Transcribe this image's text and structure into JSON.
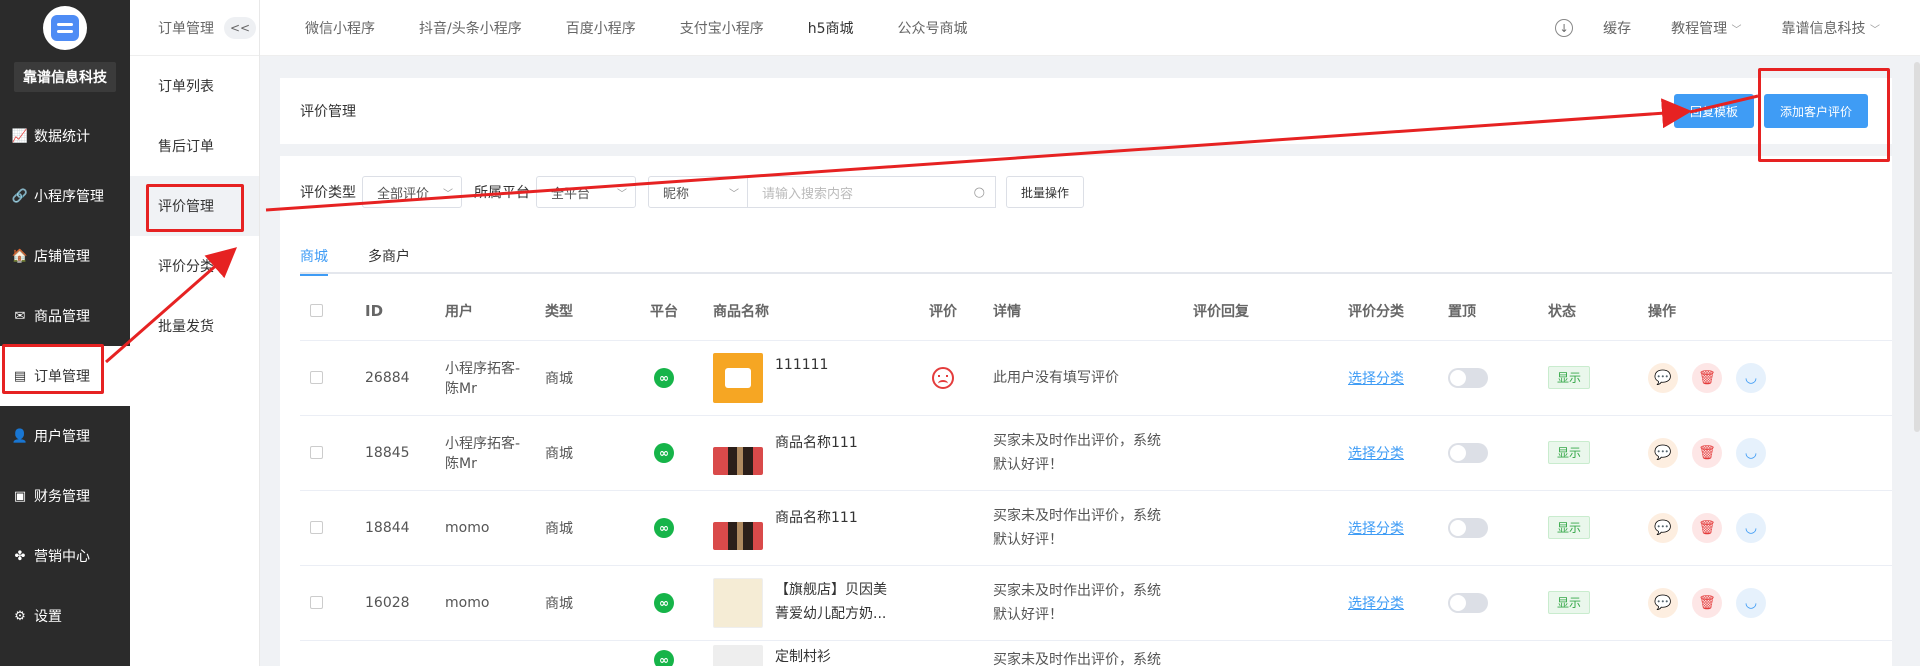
{
  "sidebar": {
    "company": "靠谱信息科技",
    "items": [
      {
        "label": "数据统计",
        "icon": "chart-icon"
      },
      {
        "label": "小程序管理",
        "icon": "link-icon"
      },
      {
        "label": "店铺管理",
        "icon": "store-icon"
      },
      {
        "label": "商品管理",
        "icon": "goods-icon"
      },
      {
        "label": "订单管理",
        "icon": "order-icon"
      },
      {
        "label": "用户管理",
        "icon": "user-icon"
      },
      {
        "label": "财务管理",
        "icon": "finance-icon"
      },
      {
        "label": "营销中心",
        "icon": "marketing-icon"
      },
      {
        "label": "设置",
        "icon": "gear-icon"
      }
    ]
  },
  "subnav": {
    "title": "订单管理",
    "collapse": "<<",
    "items": [
      "订单列表",
      "售后订单",
      "评价管理",
      "评价分类",
      "批量发货"
    ]
  },
  "topbar": {
    "tabs": [
      "微信小程序",
      "抖音/头条小程序",
      "百度小程序",
      "支付宝小程序",
      "h5商城",
      "公众号商城"
    ],
    "cache": "缓存",
    "tutorial": "教程管理",
    "account": "靠谱信息科技"
  },
  "header": {
    "title": "评价管理",
    "reply_template": "回复模板",
    "add_review": "添加客户评价"
  },
  "filters": {
    "type_label": "评价类型",
    "type_value": "全部评价",
    "platform_label": "所属平台",
    "platform_value": "全平台",
    "field_value": "昵称",
    "search_placeholder": "请输入搜索内容",
    "batch": "批量操作"
  },
  "tabs": [
    "商城",
    "多商户"
  ],
  "table": {
    "columns": [
      "ID",
      "用户",
      "类型",
      "平台",
      "商品名称",
      "评价",
      "详情",
      "评价回复",
      "评价分类",
      "置顶",
      "状态",
      "操作"
    ],
    "rows": [
      {
        "id": "26884",
        "user": "小程序拓客-陈Mr",
        "type": "商城",
        "goods": "111111",
        "detail": "此用户没有填写评价",
        "category": "选择分类",
        "status": "显示"
      },
      {
        "id": "18845",
        "user": "小程序拓客-陈Mr",
        "type": "商城",
        "goods": "商品名称111",
        "detail": "买家未及时作出评价，系统默认好评！",
        "category": "选择分类",
        "status": "显示"
      },
      {
        "id": "18844",
        "user": "momo",
        "type": "商城",
        "goods": "商品名称111",
        "detail": "买家未及时作出评价，系统默认好评！",
        "category": "选择分类",
        "status": "显示"
      },
      {
        "id": "16028",
        "user": "momo",
        "type": "商城",
        "goods": "【旗舰店】贝因美菁爱幼儿配方奶...",
        "detail": "买家未及时作出评价，系统默认好评！",
        "category": "选择分类",
        "status": "显示"
      },
      {
        "goods": "定制村衫",
        "detail": "买家未及时作出评价，系统"
      }
    ]
  },
  "colors": {
    "accent": "#3f9cf5",
    "annotation": "#e62222",
    "sidebar": "#2b2b2b"
  }
}
